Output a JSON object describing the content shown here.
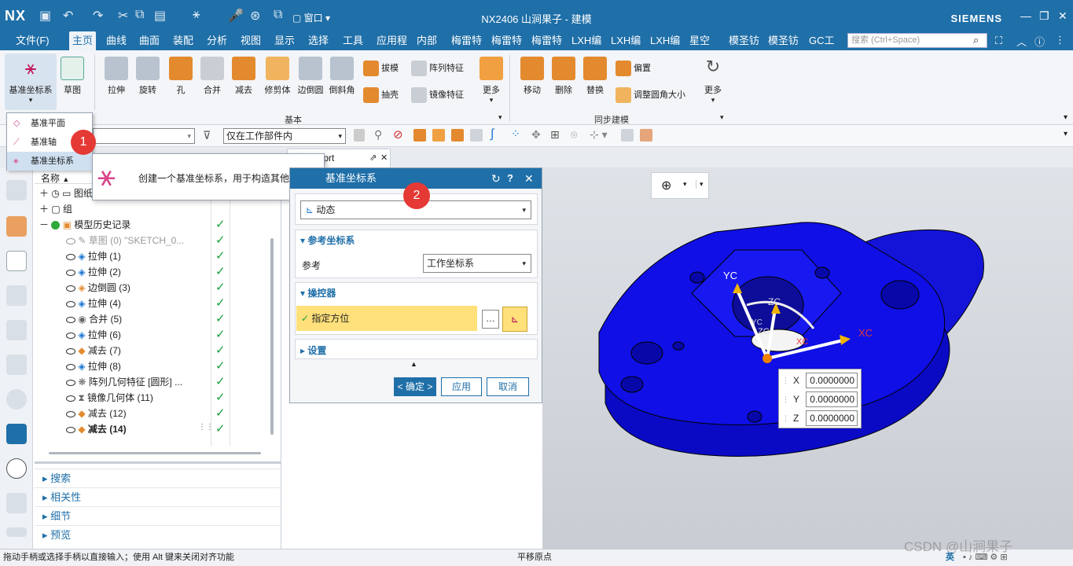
{
  "app": {
    "logo": "NX",
    "window_title": "NX2406 山涧果子 - 建模",
    "brand": "SIEMENS",
    "window_menu_label": "窗口"
  },
  "menubar": {
    "items": [
      "文件(F)",
      "主页",
      "曲线",
      "曲面",
      "装配",
      "分析",
      "视图",
      "显示",
      "选择",
      "工具",
      "应用程",
      "内部",
      "梅雷特",
      "梅雷特",
      "梅雷特",
      "LXH编",
      "LXH编",
      "LXH编",
      "星空",
      "模圣钫",
      "模圣钫",
      "GC工"
    ],
    "active": "主页",
    "search_placeholder": "搜索 (Ctrl+Space)"
  },
  "ribbon": {
    "datum_csys_label": "基准坐标系",
    "sketch_label": "草图",
    "tools": [
      "拉伸",
      "旋转",
      "孔",
      "合并",
      "减去",
      "修剪体",
      "边倒圆",
      "倒斜角"
    ],
    "small_tools_1": [
      "拔模",
      "抽壳"
    ],
    "small_tools_2": [
      "阵列特征",
      "镜像特征"
    ],
    "more_label": "更多",
    "group_basic": "基本",
    "sync_tools": [
      "移动",
      "删除",
      "替换"
    ],
    "sync_small": [
      "偏置",
      "调整圆角大小"
    ],
    "group_sync": "同步建模",
    "more_label_2": "更多"
  },
  "toolbar2": {
    "filter_combo": "仅在工作部件内"
  },
  "tabs": {
    "file_tab": "侧视图.prt"
  },
  "dropdown": {
    "items": [
      "基准平面",
      "基准轴",
      "基准坐标系"
    ],
    "badge1": "1"
  },
  "tooltip": {
    "text": "创建一个基准坐标系，用于构造其他特征。"
  },
  "navigator": {
    "header_name": "名称",
    "rows": [
      {
        "label": "图纸",
        "status": ""
      },
      {
        "label": "组",
        "status": ""
      },
      {
        "label": "模型历史记录",
        "status": "✓"
      },
      {
        "label": "草图 (0) \"SKETCH_0...",
        "status": "✓"
      },
      {
        "label": "拉伸 (1)",
        "status": "✓"
      },
      {
        "label": "拉伸 (2)",
        "status": "✓"
      },
      {
        "label": "边倒圆 (3)",
        "status": "✓"
      },
      {
        "label": "拉伸 (4)",
        "status": "✓"
      },
      {
        "label": "合并 (5)",
        "status": "✓"
      },
      {
        "label": "拉伸 (6)",
        "status": "✓"
      },
      {
        "label": "减去 (7)",
        "status": "✓"
      },
      {
        "label": "拉伸 (8)",
        "status": "✓"
      },
      {
        "label": "阵列几何特征 [圆形] ...",
        "status": "✓"
      },
      {
        "label": "镜像几何体 (11)",
        "status": "✓"
      },
      {
        "label": "减去 (12)",
        "status": "✓"
      },
      {
        "label": "减去 (14)",
        "status": "✓"
      }
    ],
    "sections": [
      "搜索",
      "相关性",
      "细节",
      "预览"
    ]
  },
  "dialog": {
    "title": "基准坐标系",
    "type_value": "动态",
    "badge2": "2",
    "ref_section": "参考坐标系",
    "ref_label": "参考",
    "ref_value": "工作坐标系",
    "manip_section": "操控器",
    "specify_orient": "指定方位",
    "settings_section": "设置",
    "ok": "< 确定 >",
    "apply": "应用",
    "cancel": "取消"
  },
  "viewport": {
    "axis_labels": [
      "YC",
      "ZC",
      "ZC",
      "XC",
      "XC",
      "YC"
    ],
    "coords": [
      {
        "axis": "X",
        "value": "0.0000000"
      },
      {
        "axis": "Y",
        "value": "0.0000000"
      },
      {
        "axis": "Z",
        "value": "0.0000000"
      }
    ]
  },
  "statusbar": {
    "left": "拖动手柄或选择手柄以直接输入；使用 Alt 键来关闭对齐功能",
    "center": "平移原点",
    "watermark": "CSDN @山涧果子",
    "ime": "英"
  }
}
